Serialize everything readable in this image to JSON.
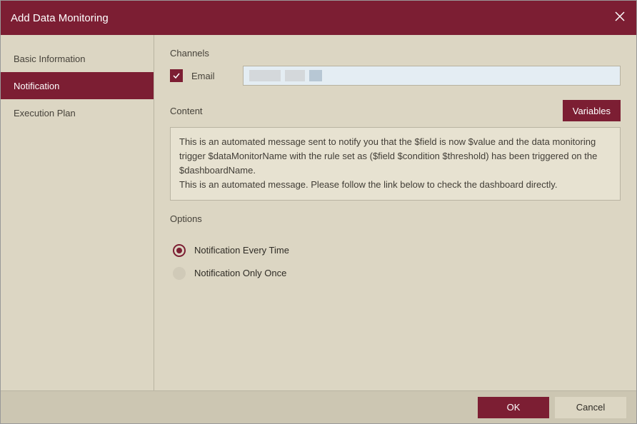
{
  "dialog": {
    "title": "Add Data Monitoring"
  },
  "sidebar": {
    "items": [
      {
        "label": "Basic Information"
      },
      {
        "label": "Notification"
      },
      {
        "label": "Execution Plan"
      }
    ]
  },
  "channels": {
    "heading": "Channels",
    "email_label": "Email",
    "email_checked": true,
    "email_value": ""
  },
  "content": {
    "heading": "Content",
    "variables_label": "Variables",
    "text_line1": "This is an automated message sent to notify you that the $field is now $value and the data monitoring trigger $dataMonitorName with the rule set as ($field $condition $threshold) has been triggered on the $dashboardName.",
    "text_line2": "This is an automated message. Please follow the link below to check the dashboard directly."
  },
  "options": {
    "heading": "Options",
    "items": [
      {
        "label": "Notification Every Time",
        "selected": true
      },
      {
        "label": "Notification Only Once",
        "selected": false
      }
    ]
  },
  "footer": {
    "ok_label": "OK",
    "cancel_label": "Cancel"
  }
}
